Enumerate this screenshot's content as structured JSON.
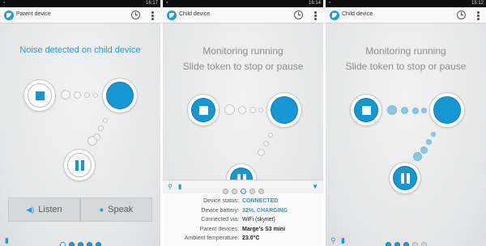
{
  "screens": [
    {
      "statusbar": {
        "time": "16:17",
        "left_icon": "app-notification-icon"
      },
      "title": "Parent device",
      "headline": "Noise detected on child device",
      "buttons": {
        "listen": "Listen",
        "speak": "Speak"
      },
      "pager_active": 0
    },
    {
      "statusbar": {
        "time": "16:14",
        "left_icon": "app-notification-icon"
      },
      "title": "Child device",
      "headline_line1": "Monitoring running",
      "headline_line2": "Slide token to stop or pause",
      "info": {
        "rows": [
          {
            "label": "Device status:",
            "value": "CONNECTED"
          },
          {
            "label": "Device battery:",
            "value": "32%, CHARGING"
          },
          {
            "label": "Connected via:",
            "value": "WiFi (skynet)"
          },
          {
            "label": "Parent devices:",
            "value": "Marge's S3 mini"
          },
          {
            "label": "Ambient temperature:",
            "value": "23.0°C"
          }
        ]
      }
    },
    {
      "statusbar": {
        "time": "15:12",
        "left_icon": "app-notification-icon"
      },
      "title": "Child device",
      "headline_line1": "Monitoring running",
      "headline_line2": "Slide token to stop or pause"
    }
  ],
  "icons": {
    "clock": "clock-icon",
    "menu": "overflow-menu-icon",
    "stop": "stop-icon",
    "pause": "pause-icon",
    "listen": "speaker-icon",
    "speak": "microphone-icon",
    "battery": "battery-icon",
    "signal": "signal-icon",
    "collapse": "chevron-down-icon"
  },
  "colors": {
    "accent": "#1e9bd7",
    "accent_dark": "#1497d2"
  }
}
